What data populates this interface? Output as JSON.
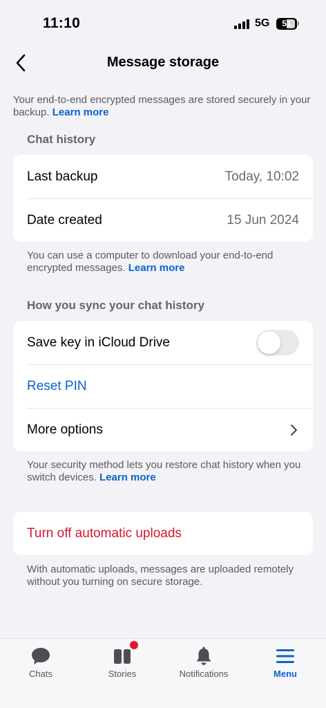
{
  "status_bar": {
    "time": "11:10",
    "network": "5G",
    "battery": "51"
  },
  "header": {
    "title": "Message storage"
  },
  "intro": {
    "text": "Your end-to-end encrypted messages are stored securely in your backup. ",
    "link": "Learn more"
  },
  "chat_history": {
    "header": "Chat history",
    "rows": [
      {
        "label": "Last backup",
        "value": "Today, 10:02"
      },
      {
        "label": "Date created",
        "value": "15 Jun 2024"
      }
    ],
    "footnote": "You can use a computer to download your end-to-end encrypted messages. ",
    "footnote_link": "Learn more"
  },
  "sync": {
    "header": "How you sync your chat history",
    "save_key_label": "Save key in iCloud Drive",
    "save_key_enabled": false,
    "reset_pin_label": "Reset PIN",
    "more_options_label": "More options",
    "footnote": "Your security method lets you restore chat history when you switch devices. ",
    "footnote_link": "Learn more"
  },
  "uploads": {
    "turn_off_label": "Turn off automatic uploads",
    "footnote": "With automatic uploads, messages are uploaded remotely without you turning on secure storage."
  },
  "tab_bar": {
    "tabs": [
      {
        "label": "Chats",
        "icon": "chat-bubble-icon"
      },
      {
        "label": "Stories",
        "icon": "stories-icon"
      },
      {
        "label": "Notifications",
        "icon": "bell-icon"
      },
      {
        "label": "Menu",
        "icon": "menu-icon"
      }
    ],
    "active": "Menu"
  },
  "colors": {
    "accent": "#0a63cc",
    "destructive": "#d6172e",
    "badge": "#e0162b",
    "background": "#f2f2f7"
  }
}
